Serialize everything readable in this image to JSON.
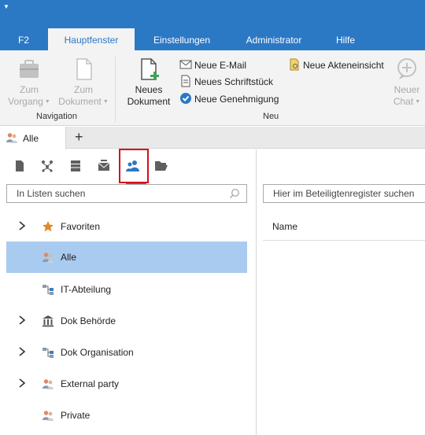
{
  "ribbon_tabs": [
    {
      "label": "F2",
      "active": false
    },
    {
      "label": "Hauptfenster",
      "active": true
    },
    {
      "label": "Einstellungen",
      "active": false
    },
    {
      "label": "Administrator",
      "active": false
    },
    {
      "label": "Hilfe",
      "active": false
    }
  ],
  "ribbon": {
    "navigation": {
      "group_label": "Navigation",
      "zum_vorgang": {
        "line1": "Zum",
        "line2": "Vorgang"
      },
      "zum_dokument": {
        "line1": "Zum",
        "line2": "Dokument"
      }
    },
    "neu": {
      "group_label": "Neu",
      "neues_dokument": {
        "line1": "Neues",
        "line2": "Dokument"
      },
      "neue_email": "Neue E-Mail",
      "neues_schriftstueck": "Neues Schriftstück",
      "neue_genehmigung": "Neue Genehmigung",
      "neue_akteneinsicht": "Neue Akteneinsicht",
      "neuer_chat": {
        "line1": "Neuer",
        "line2": "Chat"
      }
    }
  },
  "doc_tabs": {
    "active_tab": "Alle",
    "add_symbol": "+"
  },
  "left_pane": {
    "search_placeholder": "In Listen suchen",
    "tree": [
      {
        "label": "Favoriten",
        "icon": "star-icon",
        "expandable": true,
        "selected": false
      },
      {
        "label": "Alle",
        "icon": "people-icon",
        "expandable": false,
        "selected": true
      },
      {
        "label": "IT-Abteilung",
        "icon": "org-unit-icon",
        "expandable": false,
        "selected": false
      },
      {
        "label": "Dok Behörde",
        "icon": "authority-building-icon",
        "expandable": true,
        "selected": false
      },
      {
        "label": "Dok Organisation",
        "icon": "org-unit-icon",
        "expandable": true,
        "selected": false
      },
      {
        "label": "External party",
        "icon": "people-icon",
        "expandable": true,
        "selected": false
      },
      {
        "label": "Private",
        "icon": "people-icon",
        "expandable": false,
        "selected": false
      }
    ]
  },
  "right_pane": {
    "search_placeholder": "Hier im Beteiligtenregister suchen",
    "column_header": "Name"
  },
  "colors": {
    "accent": "#2b78c5",
    "selection": "#a9cbef",
    "highlight_border": "#d4101a",
    "star": "#e08a2c"
  }
}
